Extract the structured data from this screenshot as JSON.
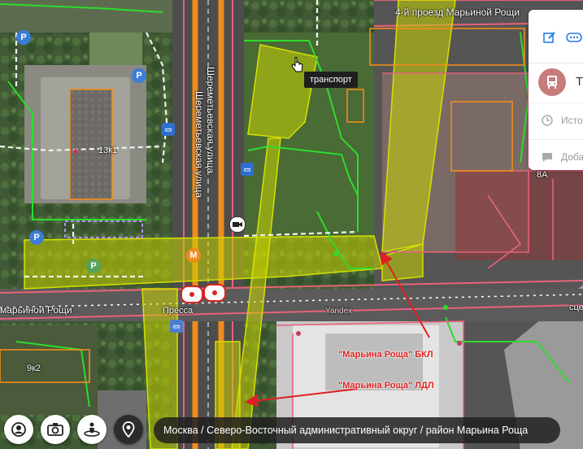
{
  "map": {
    "streets": {
      "top_right": "4-й проезд Марьиной Рощи",
      "vertical_1": "Шереметьевская улица",
      "vertical_2": "Шереметьевская улица",
      "left_bottom": "марьиной Рощи",
      "right_edge": "сце"
    },
    "buildings": {
      "b1": "13к1",
      "b2": "9к2",
      "b3": "8А"
    },
    "pois": {
      "press": "Пресса",
      "yandex": "Yandex"
    },
    "pin_letters": {
      "parking": "P",
      "metro": "M",
      "bus": "▭"
    },
    "tooltip": "транспорт",
    "annotations": {
      "bkl": "\"Марьина Роща\" БКЛ",
      "ldl": "\"Марьина Роща\" ЛДЛ"
    }
  },
  "side_panel": {
    "title_prefix": "Т",
    "row_history": "Исто",
    "row_add": "Доба"
  },
  "breadcrumb": "Москва / Северо-Восточный административный округ / район Марьина Роща",
  "colors": {
    "highlight": "#c8d400",
    "annotation_red": "#e02020",
    "road_orange": "#f08c1c",
    "boundary_green": "#2ddc2d",
    "parcel_pink": "#e8627a"
  },
  "icons": [
    "cursor-icon",
    "edit-icon",
    "more-icon",
    "bus-icon",
    "history-icon",
    "comment-icon",
    "user-location-icon",
    "camera-icon",
    "panorama-icon",
    "placemark-icon",
    "video-camera-icon",
    "parking-icon",
    "metro-icon",
    "bus-stop-icon",
    "eye-icon",
    "news-kiosk-icon"
  ]
}
